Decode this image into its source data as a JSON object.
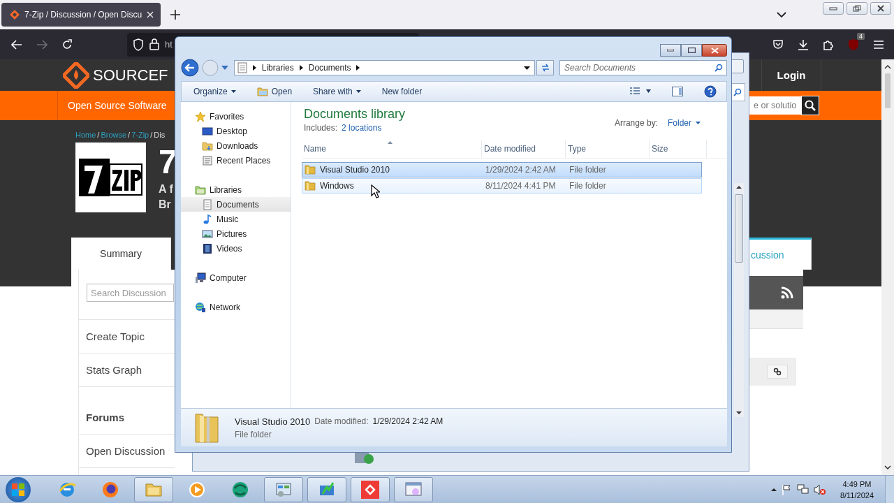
{
  "browser": {
    "tabs": [
      {
        "title": "7-Zip / Discussion / Open Discu",
        "selected": true
      }
    ],
    "url_prefix": "ht",
    "addon_badge": "4"
  },
  "site": {
    "logo_text": "SOURCEF",
    "login": "Login",
    "nav_label": "Open Source Software",
    "search_value": "e or solutio",
    "breadcrumb": [
      {
        "label": "Home",
        "link": true
      },
      {
        "label": "Browse",
        "link": true
      },
      {
        "label": "7-Zip",
        "link": true
      },
      {
        "label": "Dis",
        "link": false
      }
    ],
    "breadcrumb_separator": "/",
    "project_title": "7",
    "tagline_lines": [
      "A f",
      "Br"
    ],
    "tabs": [
      {
        "label": "Summary",
        "selected": false
      },
      {
        "label": "cussion",
        "selected": true
      }
    ],
    "search_placeholder": "Search Discussion",
    "sidebar": [
      {
        "label": "Create Topic",
        "kind": "link"
      },
      {
        "label": "Stats Graph",
        "kind": "link"
      },
      {
        "label": "Forums",
        "kind": "heading"
      },
      {
        "label": "Open Discussion",
        "kind": "link"
      }
    ]
  },
  "explorer": {
    "breadcrumb": [
      "Libraries",
      "Documents"
    ],
    "search_placeholder": "Search Documents",
    "commands": [
      {
        "label": "Organize",
        "dropdown": true
      },
      {
        "label": "Open",
        "dropdown": false
      },
      {
        "label": "Share with",
        "dropdown": true
      },
      {
        "label": "New folder",
        "dropdown": false
      }
    ],
    "nav": [
      {
        "label": "Favorites",
        "selected": false,
        "children": [
          {
            "label": "Desktop",
            "selected": false
          },
          {
            "label": "Downloads",
            "selected": false
          },
          {
            "label": "Recent Places",
            "selected": false
          }
        ]
      },
      {
        "label": "Libraries",
        "selected": false,
        "children": [
          {
            "label": "Documents",
            "selected": true
          },
          {
            "label": "Music",
            "selected": false
          },
          {
            "label": "Pictures",
            "selected": false
          },
          {
            "label": "Videos",
            "selected": false
          }
        ]
      },
      {
        "label": "Computer",
        "selected": false
      },
      {
        "label": "Network",
        "selected": false
      }
    ],
    "library_title": "Documents library",
    "includes_label": "Includes:",
    "includes_link": "2 locations",
    "arrange_label": "Arrange by:",
    "arrange_value": "Folder",
    "columns": [
      "Name",
      "Date modified",
      "Type",
      "Size"
    ],
    "rows": [
      {
        "name": "Visual Studio 2010",
        "date": "1/29/2024 2:42 AM",
        "type": "File folder",
        "selected": true,
        "hovered": false
      },
      {
        "name": "Windows",
        "date": "8/11/2024 4:41 PM",
        "type": "File folder",
        "selected": false,
        "hovered": true
      }
    ],
    "details": {
      "name": "Visual Studio 2010",
      "date_label": "Date modified:",
      "date": "1/29/2024 2:42 AM",
      "type": "File folder"
    }
  },
  "taskbar": {
    "apps": [
      {
        "kind": "ie",
        "running": false
      },
      {
        "kind": "firefox",
        "running": false
      },
      {
        "kind": "folder",
        "running": true
      },
      {
        "kind": "media",
        "running": false
      },
      {
        "kind": "sphere",
        "running": false
      },
      {
        "kind": "panel",
        "running": true
      },
      {
        "kind": "chart",
        "running": true
      },
      {
        "kind": "remote",
        "running": true
      },
      {
        "kind": "window",
        "running": true
      }
    ],
    "time": "4:49 PM",
    "date": "8/11/2024"
  }
}
